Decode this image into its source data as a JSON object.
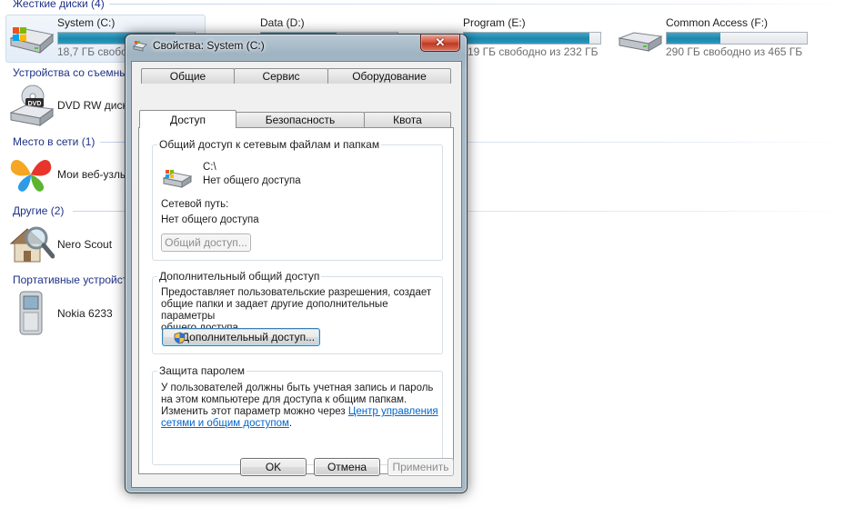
{
  "explorer": {
    "groups": {
      "hard_drives": "Жесткие диски (4)",
      "removable": "Устройства со съемны",
      "network": "Место в сети (1)",
      "other": "Другие (2)",
      "portable": "Портативные устройст"
    },
    "drives": [
      {
        "name": "System (C:)",
        "free_text": "18,7 ГБ свобод",
        "used_fraction": 0.86
      },
      {
        "name": "Data (D:)",
        "free_text": "",
        "used_fraction": 0.55
      },
      {
        "name": "Program (E:)",
        "free_text": "19 ГБ свободно из 232 ГБ",
        "used_fraction": 0.92
      },
      {
        "name": "Common Access (F:)",
        "free_text": "290 ГБ свободно из 465 ГБ",
        "used_fraction": 0.38
      }
    ],
    "dvd": {
      "name": "DVD RW диск"
    },
    "network_item": {
      "name": "Мои веб-узлы"
    },
    "other_item": {
      "name": "Nero Scout"
    },
    "portable_item": {
      "name": "Nokia 6233"
    }
  },
  "dialog": {
    "title": "Свойства: System (C:)",
    "tabs_row1": [
      "Общие",
      "Сервис",
      "Оборудование"
    ],
    "tabs_row2": [
      "Доступ",
      "Безопасность",
      "Квота"
    ],
    "network_sharing": {
      "title": "Общий доступ к сетевым файлам и папкам",
      "path": "C:\\",
      "status": "Нет общего доступа",
      "net_path_label": "Сетевой путь:",
      "net_path_value": "Нет общего доступа",
      "share_button": "Общий доступ..."
    },
    "advanced_sharing": {
      "title": "Дополнительный общий доступ",
      "description_l1": "Предоставляет пользовательские разрешения, создает",
      "description_l2": "общие папки и задает другие дополнительные параметры",
      "description_l3": "общего доступа.",
      "button": "Дополнительный доступ..."
    },
    "password_protection": {
      "title": "Защита паролем",
      "line1": "У пользователей должны быть учетная запись и пароль",
      "line2": "на этом компьютере для доступа к общим папкам.",
      "line3": "Изменить этот параметр можно через ",
      "link_part1": "Центр управления",
      "link_part2": "сетями и общим доступом",
      "tail": "."
    },
    "buttons": {
      "ok": "OK",
      "cancel": "Отмена",
      "apply": "Применить"
    }
  },
  "colors": {
    "accent_bar": "#1d86ab",
    "header_text": "#1e3287",
    "link": "#0066cc"
  }
}
